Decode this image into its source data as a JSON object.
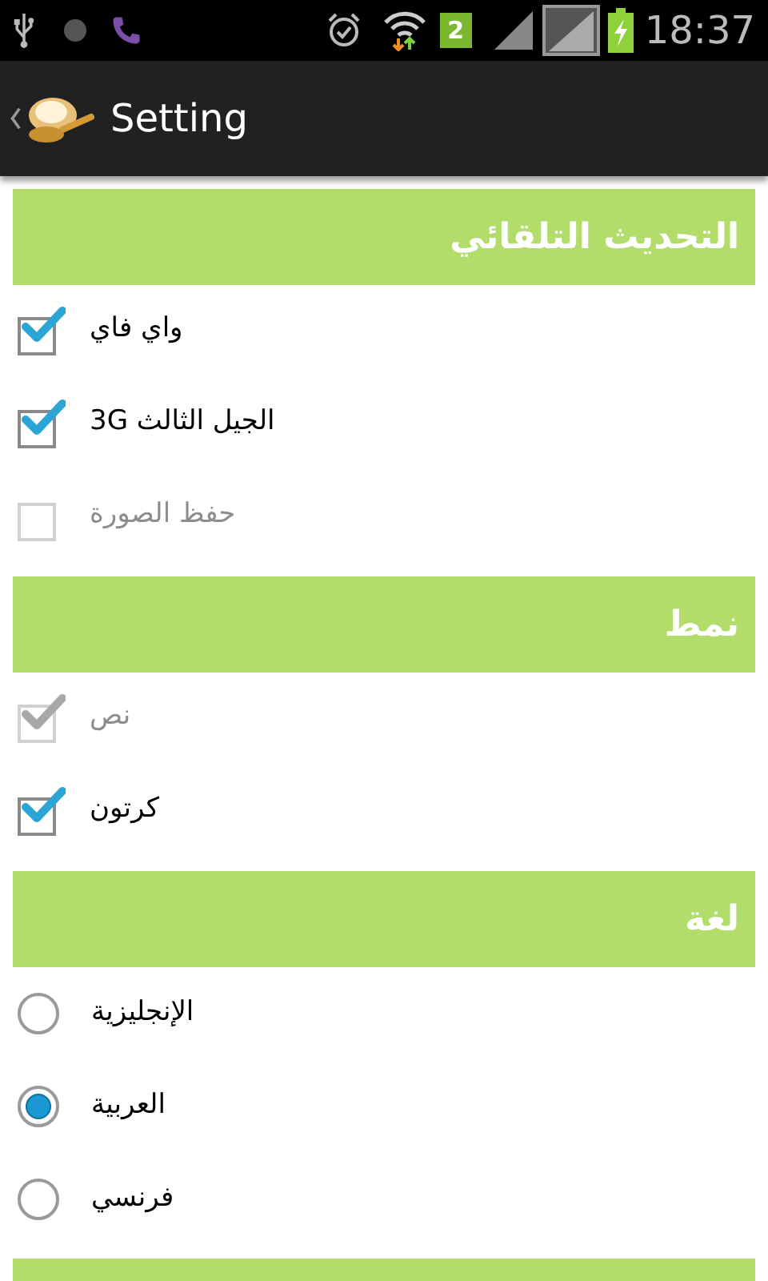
{
  "status_bar": {
    "sim_badge": "2",
    "time": "18:37"
  },
  "action_bar": {
    "title": "Setting"
  },
  "sections": [
    {
      "title": "التحديث التلقائي",
      "items": [
        {
          "kind": "checkbox",
          "label": "واي فاي",
          "checked": true,
          "disabled": false
        },
        {
          "kind": "checkbox",
          "label": "الجيل الثالث 3G",
          "checked": true,
          "disabled": false
        },
        {
          "kind": "checkbox",
          "label": "حفظ الصورة",
          "checked": false,
          "disabled": true
        }
      ]
    },
    {
      "title": "نمط",
      "items": [
        {
          "kind": "checkbox",
          "label": "نص",
          "checked": true,
          "disabled": true
        },
        {
          "kind": "checkbox",
          "label": "كرتون",
          "checked": true,
          "disabled": false
        }
      ]
    },
    {
      "title": "لغة",
      "items": [
        {
          "kind": "radio",
          "label": "الإنجليزية",
          "selected": false
        },
        {
          "kind": "radio",
          "label": "العربية",
          "selected": true
        },
        {
          "kind": "radio",
          "label": "فرنسي",
          "selected": false
        }
      ]
    }
  ]
}
